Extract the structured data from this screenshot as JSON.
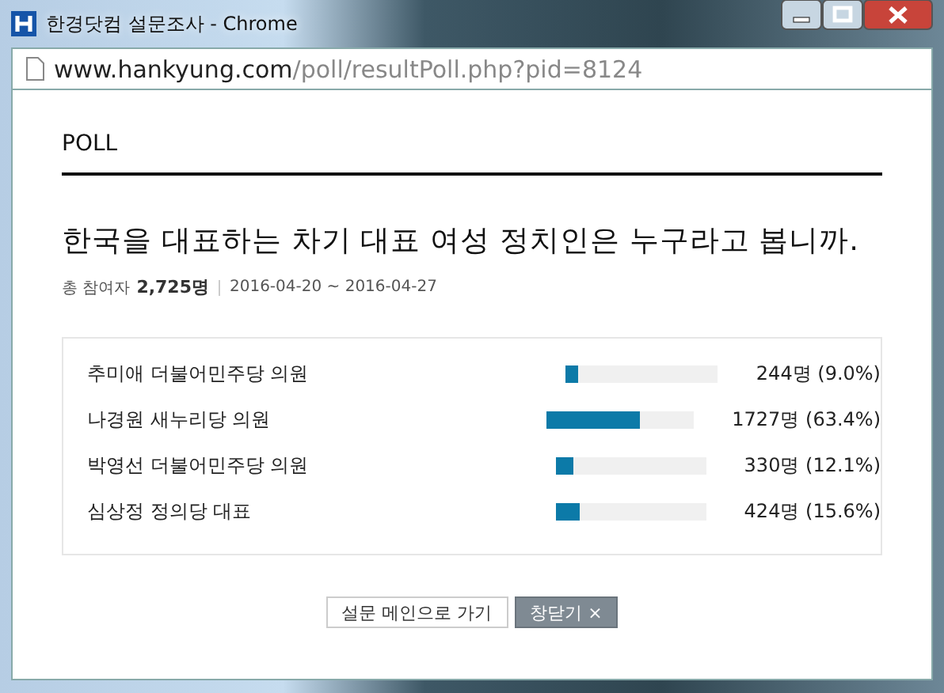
{
  "window": {
    "title": "한경닷컴 설문조사 - Chrome"
  },
  "address_bar": {
    "host": "www.hankyung.com",
    "path": "/poll/resultPoll.php?pid=8124"
  },
  "section_label": "POLL",
  "question": "한국을 대표하는 차기 대표 여성 정치인은 누구라고 봅니까.",
  "meta": {
    "participants_label": "총 참여자",
    "participants": "2,725명",
    "period": "2016-04-20 ~ 2016-04-27"
  },
  "results": [
    {
      "name": "추미애 더불어민주당 의원",
      "level": 0.09,
      "reading": "244명 (9.0%)"
    },
    {
      "name": "나경원 새누리당 의원",
      "level": 0.634,
      "reading": "1727명 (63.4%)"
    },
    {
      "name": "박영선 더불어민주당 의원",
      "level": 0.121,
      "reading": "330명 (12.1%)"
    },
    {
      "name": "심상정 정의당 대표",
      "level": 0.156,
      "reading": "424명 (15.6%)"
    }
  ],
  "buttons": [
    {
      "label": "설문 메인으로 가기",
      "kind": "secondary"
    },
    {
      "label": "창닫기 ×",
      "kind": "primary"
    }
  ]
}
